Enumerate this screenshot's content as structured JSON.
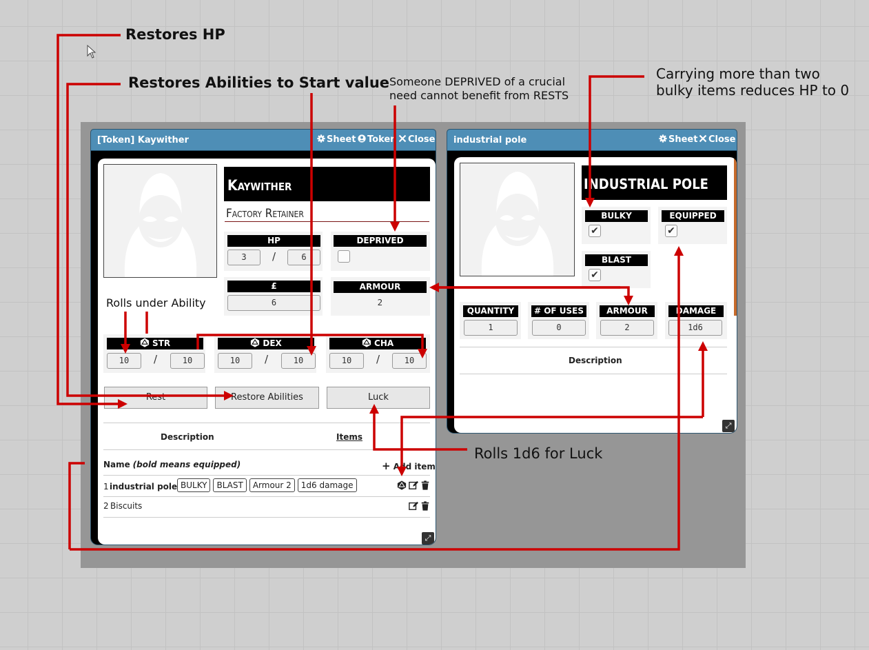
{
  "character_window": {
    "title": "[Token] Kaywither",
    "buttons": {
      "sheet": "Sheet",
      "token": "Token",
      "close": "Close"
    },
    "name": "Kaywither",
    "subtitle": "Factory Retainer",
    "hp": {
      "label": "HP",
      "current": "3",
      "max": "6"
    },
    "deprived": {
      "label": "DEPRIVED",
      "checked": false
    },
    "pounds": {
      "label": "£",
      "value": "6"
    },
    "armour": {
      "label": "ARMOUR",
      "value": "2"
    },
    "abilities": [
      {
        "label": "STR",
        "current": "10",
        "max": "10"
      },
      {
        "label": "DEX",
        "current": "10",
        "max": "10"
      },
      {
        "label": "CHA",
        "current": "10",
        "max": "10"
      }
    ],
    "actions": {
      "rest": "Rest",
      "restore": "Restore Abilities",
      "luck": "Luck"
    },
    "tabs": {
      "description": "Description",
      "items": "Items"
    },
    "items_header": {
      "name_prefix": "Name",
      "name_note": "(bold means equipped)",
      "add": "Add item"
    },
    "items": [
      {
        "qty": "1",
        "name": "industrial pole",
        "tags": [
          "BULKY",
          "BLAST",
          "Armour 2",
          "1d6 damage"
        ]
      },
      {
        "qty": "2",
        "name": "Biscuits",
        "tags": []
      }
    ]
  },
  "item_window": {
    "title": "industrial pole",
    "buttons": {
      "sheet": "Sheet",
      "close": "Close"
    },
    "name": "Industrial pole",
    "flags": [
      {
        "label": "BULKY",
        "checked": true
      },
      {
        "label": "EQUIPPED",
        "checked": true
      },
      {
        "label": "BLAST",
        "checked": true
      }
    ],
    "stats": [
      {
        "label": "QUANTITY",
        "value": "1"
      },
      {
        "label": "# OF USES",
        "value": "0"
      },
      {
        "label": "ARMOUR",
        "value": "2"
      },
      {
        "label": "DAMAGE",
        "value": "1d6"
      }
    ],
    "description_label": "Description"
  },
  "annotations": {
    "restores_hp": "Restores HP",
    "restores_abilities": "Restores Abilities to Start value",
    "deprived_line1": "Someone DEPRIVED of a crucial",
    "deprived_line2": "need cannot benefit from RESTS",
    "bulky_line1": "Carrying more than two",
    "bulky_line2": "bulky items reduces HP to 0",
    "rolls_under": "Rolls under Ability",
    "rolls_luck": "Rolls 1d6 for Luck"
  },
  "colors": {
    "titlebar": "#4e8eb6",
    "arrow": "#cc0000",
    "label_bg": "#000000"
  }
}
